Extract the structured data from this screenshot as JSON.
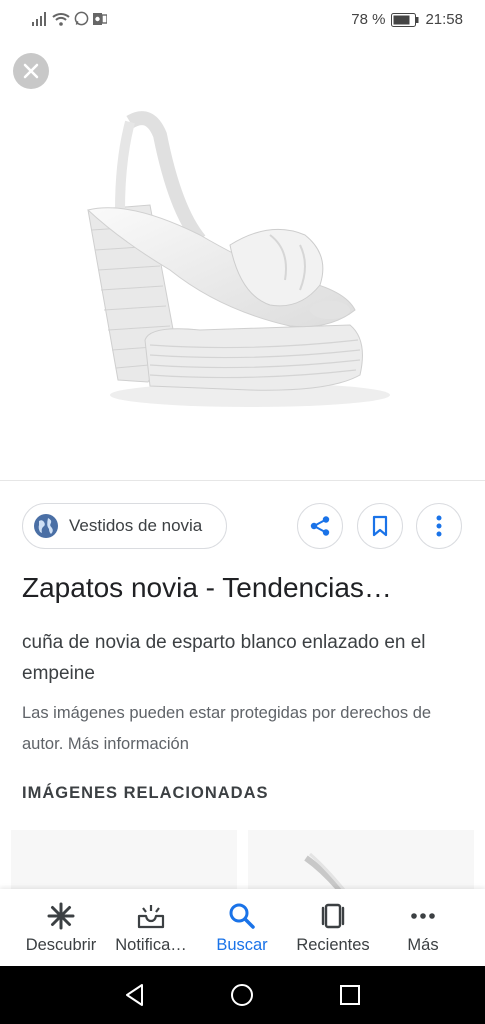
{
  "status_bar": {
    "battery": "78 %",
    "time": "21:58"
  },
  "hero": {
    "image_alt": "white wedge bridal sandal"
  },
  "source": {
    "label": "Vestidos de novia"
  },
  "result": {
    "title": "Zapatos novia - Tendencias…",
    "description": "cuña de novia de esparto blanco enlazado en el empeine",
    "copyright": "Las imágenes pueden estar protegidas por derechos de autor. Más información"
  },
  "related": {
    "heading": "IMÁGENES RELACIONADAS"
  },
  "bottom_nav": {
    "items": [
      {
        "label": "Descubrir",
        "icon": "asterisk-icon"
      },
      {
        "label": "Notifica…",
        "icon": "inbox-icon"
      },
      {
        "label": "Buscar",
        "icon": "search-icon"
      },
      {
        "label": "Recientes",
        "icon": "recent-tabs-icon"
      },
      {
        "label": "Más",
        "icon": "more-horizontal-icon"
      }
    ]
  },
  "colors": {
    "accent": "#1a73e8",
    "text": "#202124",
    "muted": "#5f6368"
  }
}
